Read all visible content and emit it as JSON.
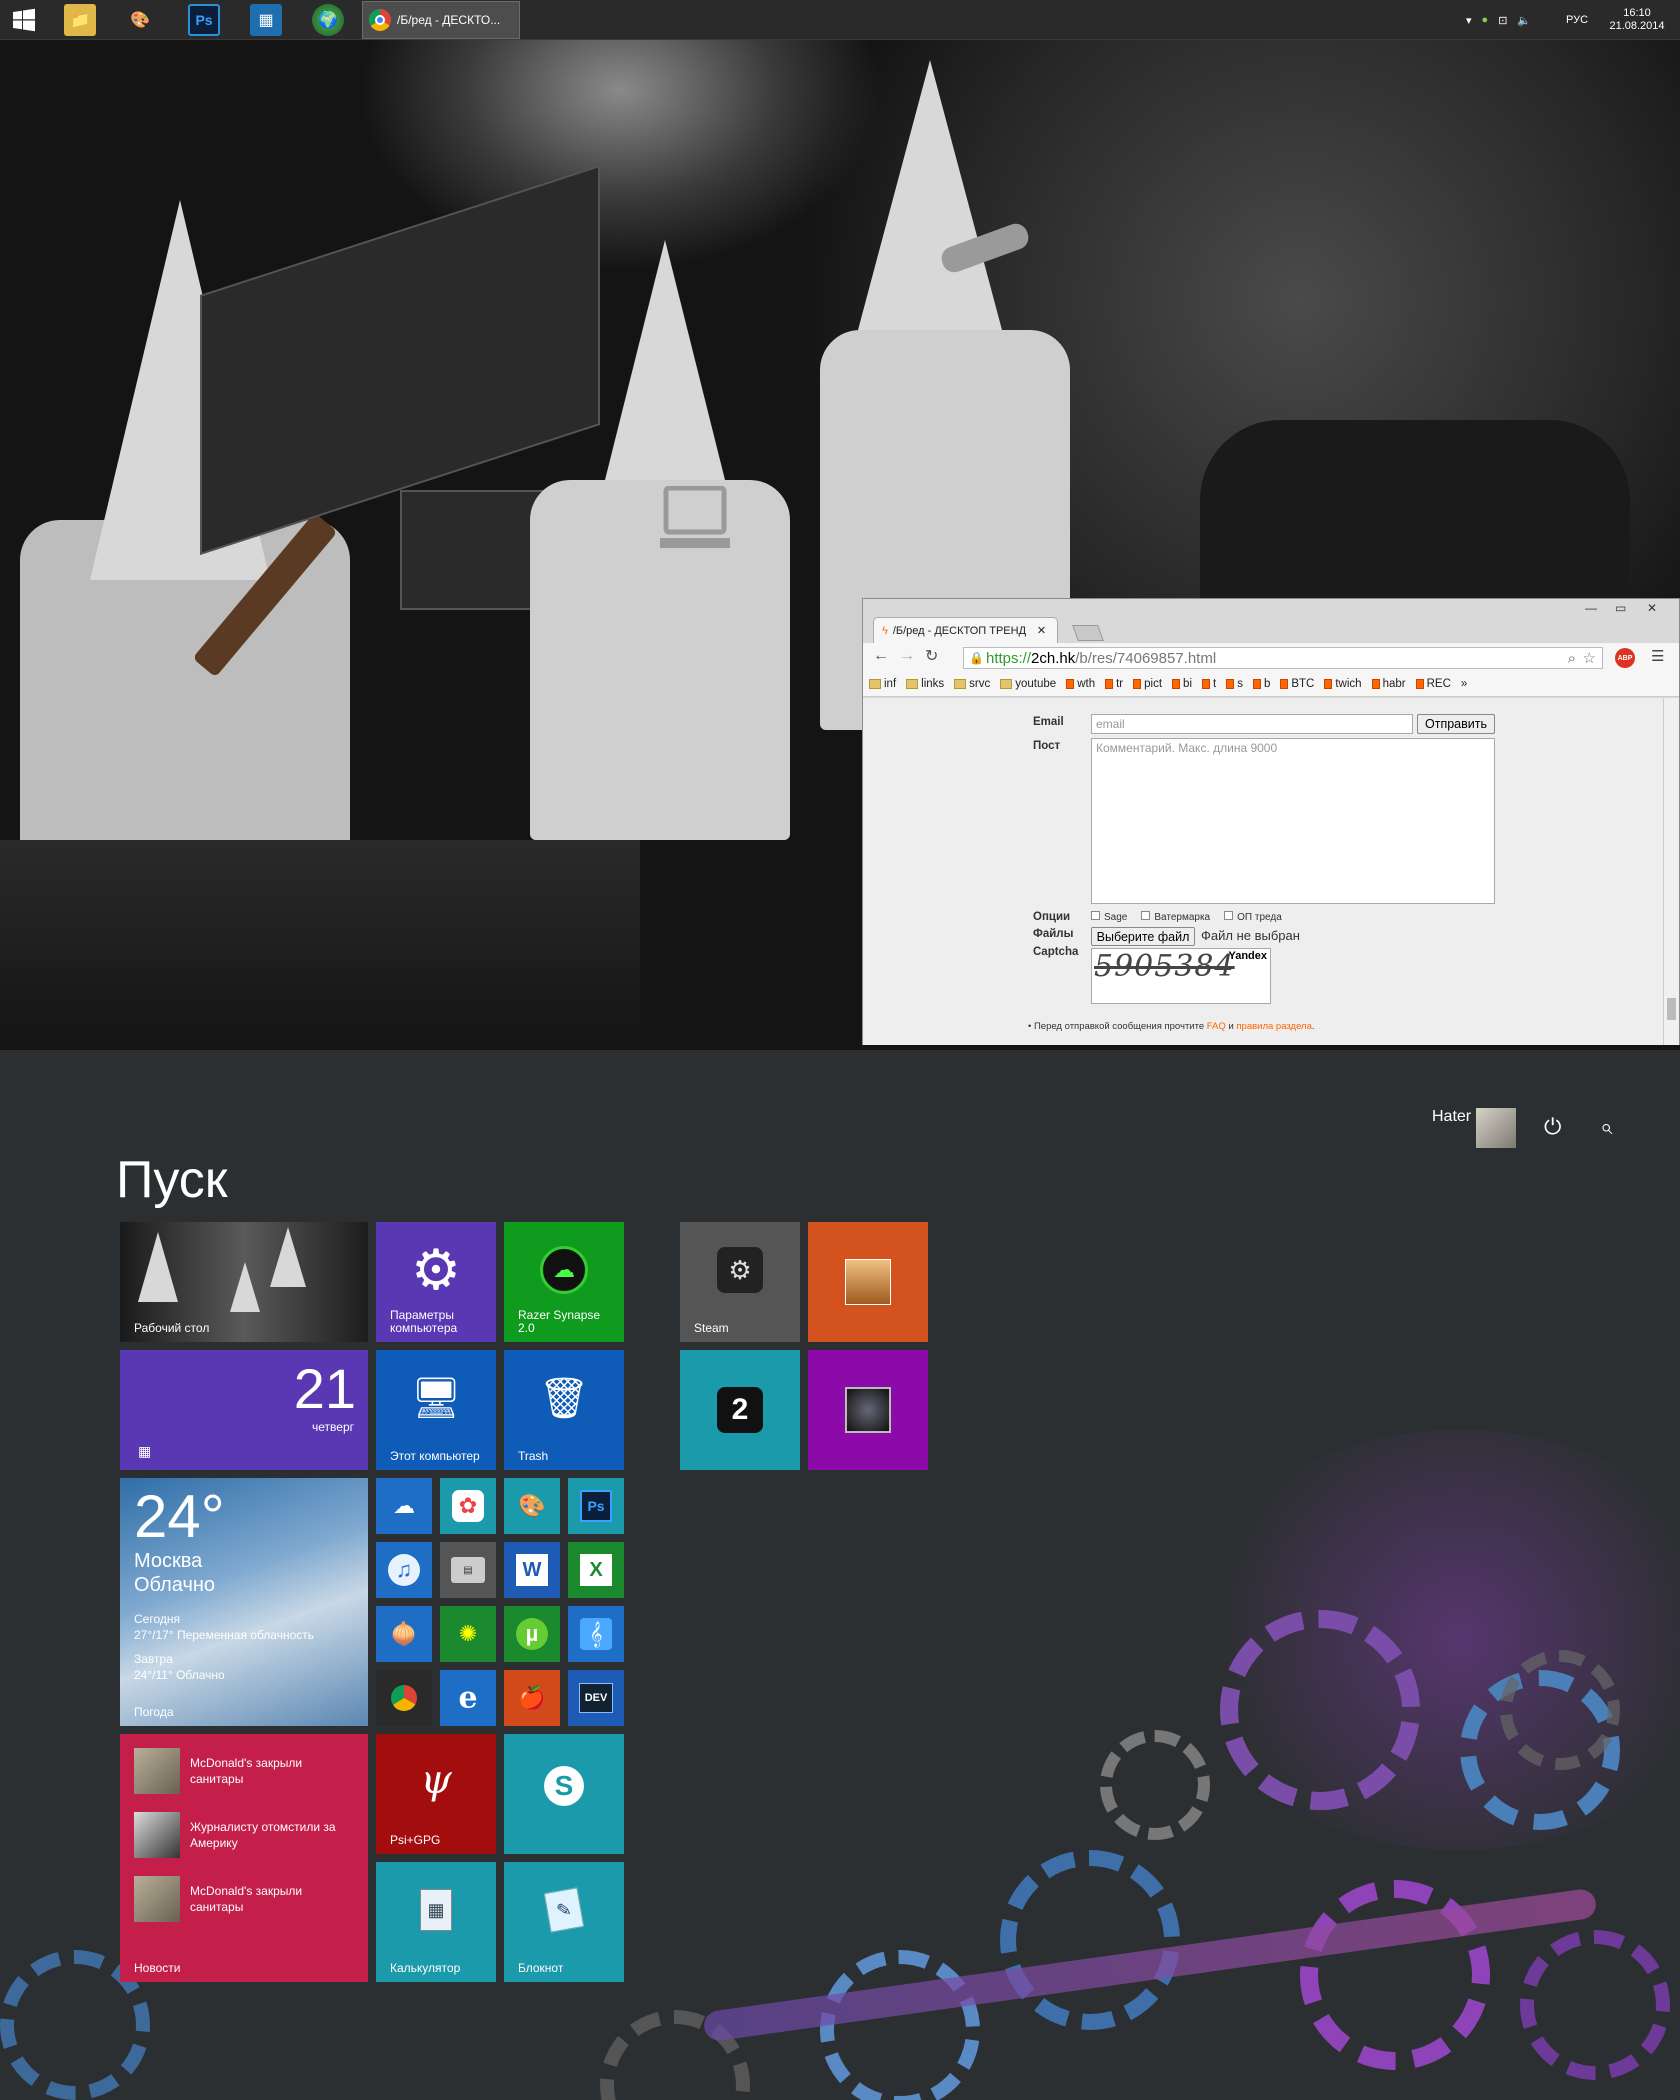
{
  "taskbar": {
    "active_task": "/Б/ред - ДЕСКТО...",
    "lang": "РУС",
    "time": "16:10",
    "date": "21.08.2014"
  },
  "browser": {
    "tab_title": "/Б/ред - ДЕСКТОП ТРЕНД",
    "url_scheme": "https://",
    "url_host": "2ch.hk",
    "url_path": "/b/res/74069857.html",
    "abp": "ABP",
    "bookmarks": [
      "inf",
      "links",
      "srvc",
      "youtube",
      "wth",
      "tr",
      "pict",
      "bi",
      "t",
      "s",
      "b",
      "BTC",
      "twich",
      "habr",
      "REC",
      "»"
    ],
    "form": {
      "email_label": "Email",
      "email_placeholder": "email",
      "submit": "Отправить",
      "post_label": "Пост",
      "post_placeholder": "Комментарий. Макс. длина 9000",
      "options_label": "Опции",
      "opt_sage": "Sage",
      "opt_watermark": "Ватермарка",
      "opt_op": "ОП треда",
      "files_label": "Файлы",
      "choose_file": "Выберите файл",
      "no_file": "Файл не выбран",
      "captcha_label": "Captcha",
      "captcha_text": "5905384",
      "captcha_brand": "Yandex",
      "notice_pre": "• Перед отправкой сообщения прочтите",
      "notice_faq": "FAQ",
      "notice_and": "и",
      "notice_rules": "правила раздела",
      "notice_end": "."
    }
  },
  "start": {
    "title": "Пуск",
    "user_name": "Hater",
    "tiles": {
      "desktop": "Рабочий стол",
      "settings": "Параметры компьютера",
      "razer": "Razer Synapse 2.0",
      "calendar_day": "21",
      "calendar_weekday": "четверг",
      "this_pc": "Этот компьютер",
      "trash": "Trash",
      "steam": "Steam",
      "weather_temp": "24°",
      "weather_city": "Москва",
      "weather_cond": "Облачно",
      "weather_today_lbl": "Сегодня",
      "weather_today": "27°/17° Переменная облачность",
      "weather_tomorrow_lbl": "Завтра",
      "weather_tomorrow": "24°/11° Облачно",
      "weather_app": "Погода",
      "psi": "Psi+GPG",
      "calc": "Калькулятор",
      "notepad": "Блокнот",
      "news_app": "Новости",
      "news": [
        "McDonald's закрыли санитары",
        "Журналисту отомстили за Америку",
        "McDonald's закрыли санитары"
      ],
      "ps": "Ps",
      "word": "W",
      "excel": "X",
      "dev": "DEV",
      "two": "2"
    }
  }
}
